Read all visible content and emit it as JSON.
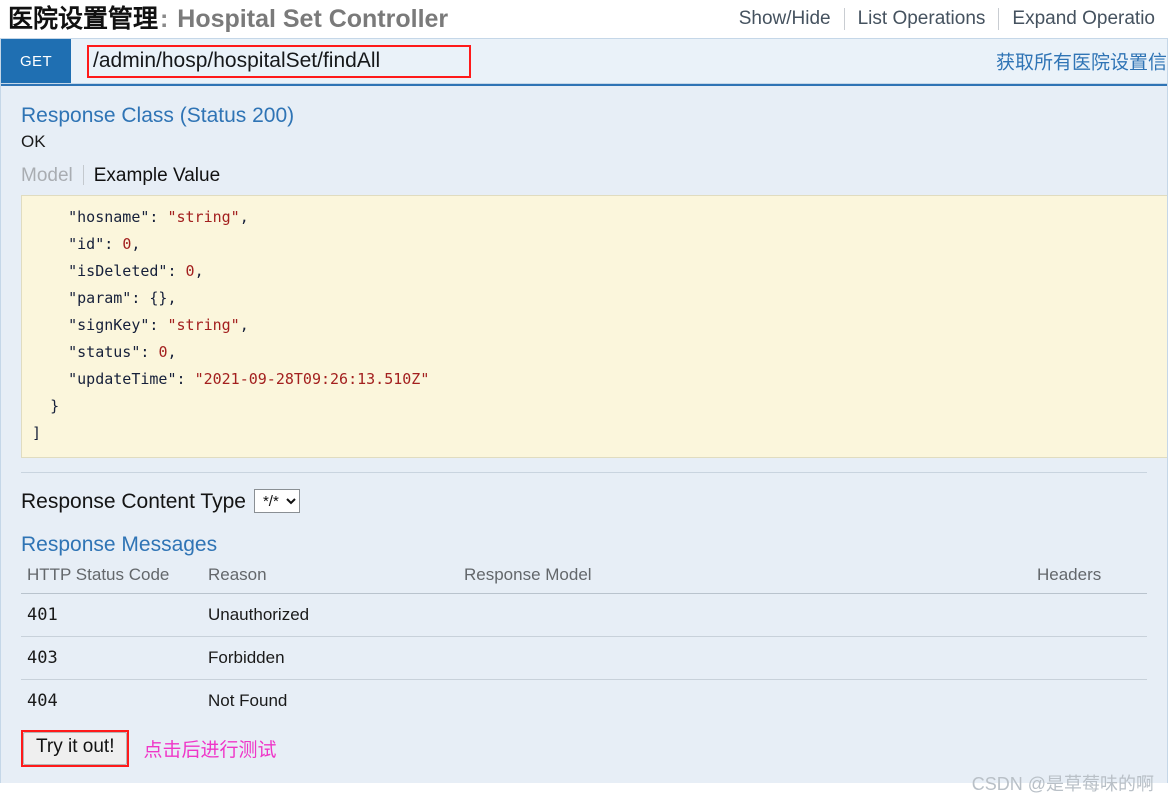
{
  "header": {
    "title_cn": "医院设置管理",
    "title_separator": ":",
    "title_en": "Hospital Set Controller",
    "options": [
      {
        "label": "Show/Hide"
      },
      {
        "label": "List Operations"
      },
      {
        "label": "Expand Operatio"
      }
    ]
  },
  "operation": {
    "method": "GET",
    "path": "/admin/hosp/hospitalSet/findAll",
    "summary": "获取所有医院设置信"
  },
  "response_class": {
    "title": "Response Class (Status 200)",
    "status_description": "OK",
    "tabs": {
      "model": "Model",
      "example_value": "Example Value"
    },
    "example_lines": [
      {
        "indent": 4,
        "key": "\"hosname\"",
        "sep": ": ",
        "value": "\"string\"",
        "vtype": "s",
        "comma": ","
      },
      {
        "indent": 4,
        "key": "\"id\"",
        "sep": ": ",
        "value": "0",
        "vtype": "n",
        "comma": ","
      },
      {
        "indent": 4,
        "key": "\"isDeleted\"",
        "sep": ": ",
        "value": "0",
        "vtype": "n",
        "comma": ","
      },
      {
        "indent": 4,
        "key": "\"param\"",
        "sep": ": ",
        "value": "{}",
        "vtype": "p",
        "comma": ","
      },
      {
        "indent": 4,
        "key": "\"signKey\"",
        "sep": ": ",
        "value": "\"string\"",
        "vtype": "s",
        "comma": ","
      },
      {
        "indent": 4,
        "key": "\"status\"",
        "sep": ": ",
        "value": "0",
        "vtype": "n",
        "comma": ","
      },
      {
        "indent": 4,
        "key": "\"updateTime\"",
        "sep": ": ",
        "value": "\"2021-09-28T09:26:13.510Z\"",
        "vtype": "s",
        "comma": ""
      },
      {
        "indent": 2,
        "key": "",
        "sep": "",
        "value": "}",
        "vtype": "p",
        "comma": ""
      },
      {
        "indent": 0,
        "key": "",
        "sep": "",
        "value": "]",
        "vtype": "p",
        "comma": ""
      }
    ]
  },
  "content_type": {
    "label": "Response Content Type",
    "selected": "*/*",
    "options": [
      "*/*"
    ]
  },
  "response_messages": {
    "title": "Response Messages",
    "columns": {
      "code": "HTTP Status Code",
      "reason": "Reason",
      "model": "Response Model",
      "headers": "Headers"
    },
    "rows": [
      {
        "code": "401",
        "reason": "Unauthorized",
        "model": "",
        "headers": ""
      },
      {
        "code": "403",
        "reason": "Forbidden",
        "model": "",
        "headers": ""
      },
      {
        "code": "404",
        "reason": "Not Found",
        "model": "",
        "headers": ""
      }
    ]
  },
  "submit": {
    "button_label": "Try it out!",
    "annotation": "点击后进行测试"
  },
  "watermark": "CSDN @是草莓味的啊",
  "colors": {
    "method_blue": "#1f6fb2",
    "panel_blue": "#e7eef6",
    "link_blue": "#2f74b5",
    "code_bg": "#fbf6dc",
    "annotation_red": "#ff1a1a",
    "annotation_pink": "#ef36c8"
  }
}
